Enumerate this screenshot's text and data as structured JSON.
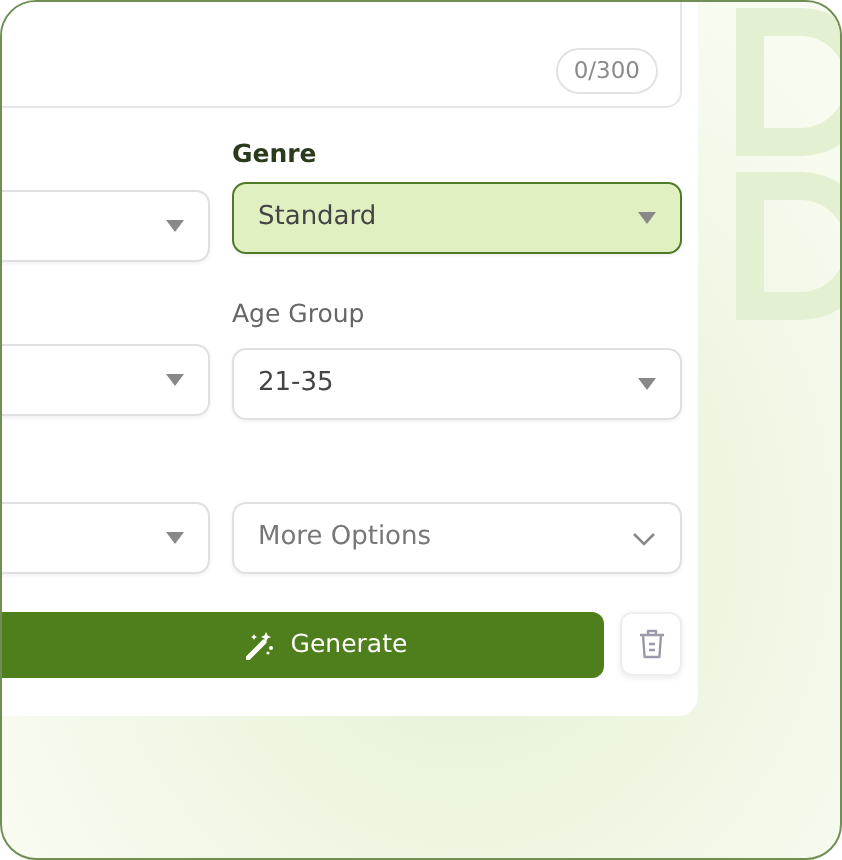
{
  "description": {
    "counter": "0/300"
  },
  "rows": [
    {
      "label": "Genre",
      "fields": [
        {
          "kind": "select",
          "highlighted": false
        },
        {
          "kind": "select",
          "value": "Standard",
          "highlighted": true
        }
      ]
    },
    {
      "label": "Age Group",
      "fields": [
        {
          "kind": "select",
          "highlighted": false
        },
        {
          "kind": "select",
          "value": "21-35",
          "highlighted": false
        }
      ]
    },
    {
      "fields": [
        {
          "kind": "select",
          "highlighted": false
        },
        {
          "kind": "dropdown",
          "placeholder": "More Options",
          "highlighted": false
        }
      ]
    }
  ],
  "actions": {
    "generate": "Generate"
  }
}
